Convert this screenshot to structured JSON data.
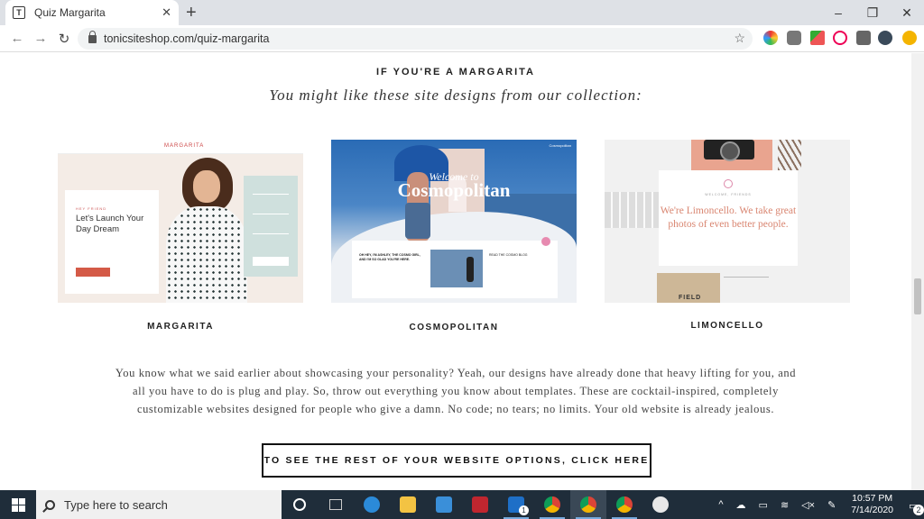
{
  "browser": {
    "tab_title": "Quiz Margarita",
    "tab_favicon": "T",
    "new_tab": "+",
    "url": "tonicsiteshop.com/quiz-margarita",
    "window_controls": [
      "–",
      "❐",
      "✕"
    ]
  },
  "page": {
    "heading": "IF YOU'RE A MARGARITA",
    "subheading": "You might like these site designs from our collection:",
    "designs": [
      {
        "name": "MARGARITA",
        "preview": {
          "logo": "MARGARITA",
          "eyebrow": "HEY FRIEND",
          "headline": "Let's Launch Your Day Dream"
        }
      },
      {
        "name": "COSMOPOLITAN",
        "preview": {
          "welcome": "Welcome to",
          "title": "Cosmopolitan",
          "post_text": "OH HEY, I'M ASHLEY, THE COSMO GIRL, AND I'M SO GLAD YOU'RE HERE.",
          "side_text": "READ THE COSMO BLOG"
        }
      },
      {
        "name": "LIMONCELLO",
        "preview": {
          "welcome": "WELCOME, FRIENDS",
          "text": "We're Limoncello. We take great photos of even better people.",
          "notebook": "FIELD"
        }
      }
    ],
    "body": "You know what we said earlier about showcasing your personality? Yeah, our designs have already done that heavy lifting for you, and all you have to do is plug and play. So, throw out everything you know about templates. These are cocktail-inspired, completely customizable websites designed for people who give a damn. No code; no tears; no limits. Your old website is already jealous.",
    "cta": "TO SEE THE REST OF YOUR WEBSITE OPTIONS, CLICK HERE"
  },
  "taskbar": {
    "search_placeholder": "Type here to search",
    "time": "10:57 PM",
    "date": "7/14/2020",
    "notification_count": "2",
    "mail_badge": "1"
  },
  "colors": {
    "margarita_button": "#d45a47",
    "limoncello_text": "#d98570",
    "taskbar_bg": "#1f2d3a"
  }
}
